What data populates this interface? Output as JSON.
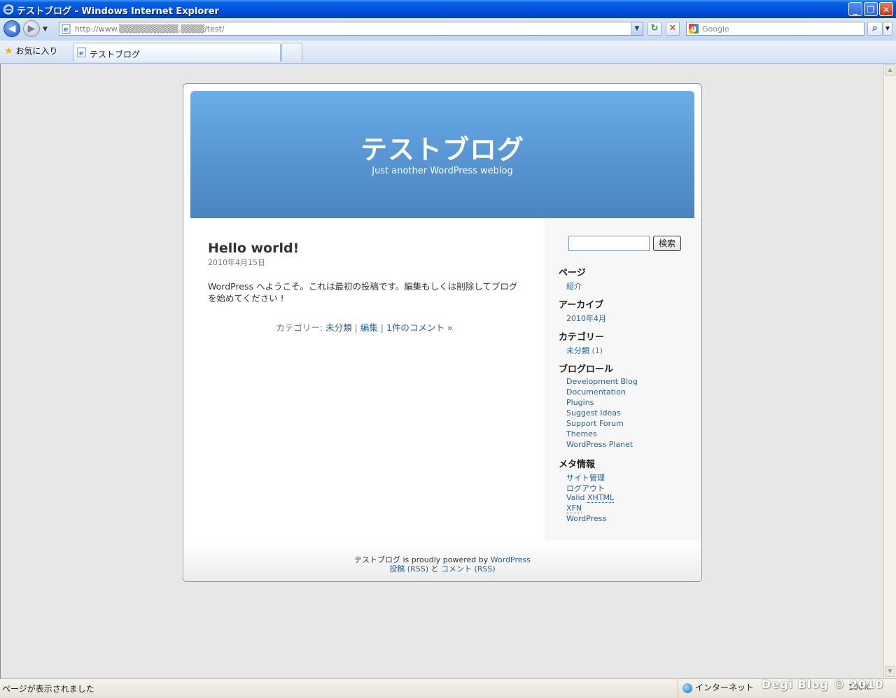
{
  "window": {
    "title": "テストブログ - Windows Internet Explorer"
  },
  "toolbar": {
    "back_label": "◀",
    "forward_label": "▶",
    "address_url": "http://www.▒▒▒▒▒▒▒▒▒▒.▒▒▒▒/test/",
    "search_placeholder": "Google"
  },
  "tabs": {
    "favorites_label": "お気に入り",
    "active_tab_title": "テストブログ"
  },
  "blog": {
    "title": "テストブログ",
    "description": "Just another WordPress weblog"
  },
  "post": {
    "title": "Hello world!",
    "date": "2010年4月15日",
    "body": "WordPress へようこそ。これは最初の投稿です。編集もしくは削除してブログを始めてください !",
    "meta_prefix": "カテゴリー: ",
    "category": "未分類",
    "sep1": " | ",
    "edit": "編集",
    "sep2": " | ",
    "comments": "1件のコメント »"
  },
  "sidebar": {
    "search_button": "検索",
    "pages_heading": "ページ",
    "pages": [
      "紹介"
    ],
    "archives_heading": "アーカイブ",
    "archives": [
      "2010年4月"
    ],
    "categories_heading": "カテゴリー",
    "category_name": "未分類",
    "category_count": "(1)",
    "blogroll_heading": "ブログロール",
    "blogroll": [
      "Development Blog",
      "Documentation",
      "Plugins",
      "Suggest Ideas",
      "Support Forum",
      "Themes",
      "WordPress Planet"
    ],
    "meta_heading": "メタ情報",
    "meta_admin": "サイト管理",
    "meta_logout": "ログアウト",
    "meta_valid_prefix": "Valid ",
    "meta_valid_abbr": "XHTML",
    "meta_xfn": "XFN",
    "meta_wordpress": "WordPress"
  },
  "footer": {
    "blog_name": "テストブログ",
    "powered_text": " is proudly powered by ",
    "wordpress": "WordPress",
    "entries_rss": "投稿 (RSS)",
    "and": " と ",
    "comments_rss": "コメント (RSS)"
  },
  "statusbar": {
    "status": "ページが表示されました",
    "zone": "インターネット",
    "zoom": "100%",
    "watermark": "Degi Blog © 2010"
  }
}
